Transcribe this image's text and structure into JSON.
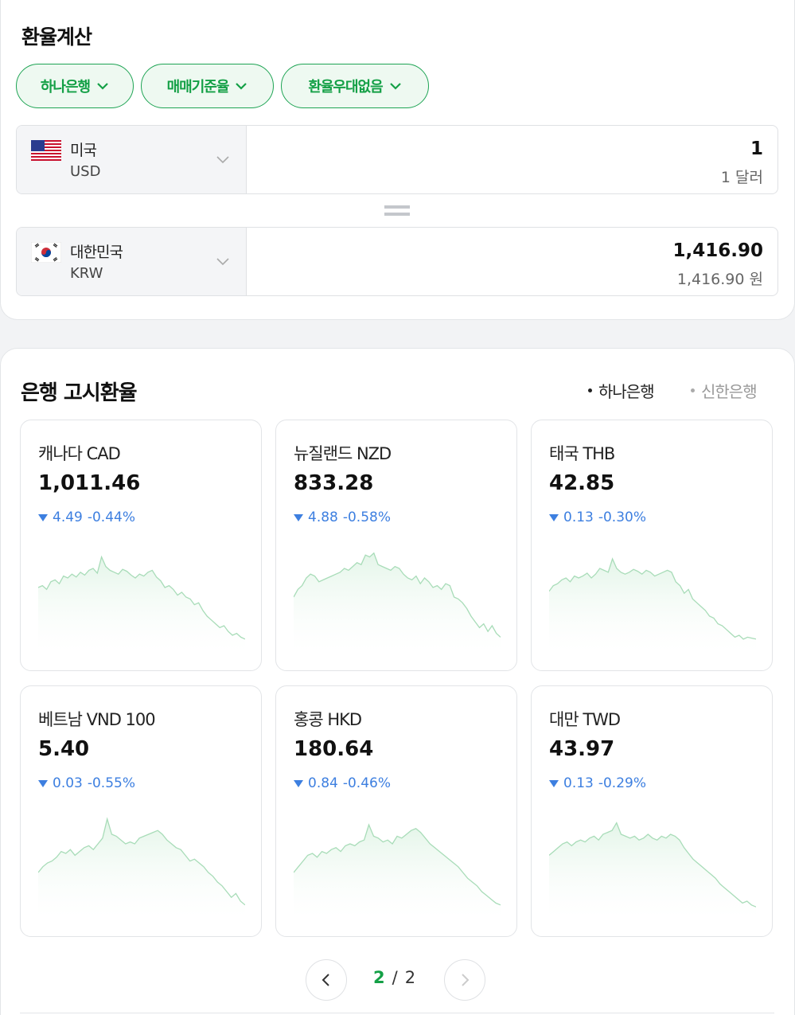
{
  "calculator": {
    "title": "환율계산",
    "chips": [
      {
        "label": "하나은행"
      },
      {
        "label": "매매기준율"
      },
      {
        "label": "환율우대없음"
      }
    ],
    "from": {
      "country": "미국",
      "code": "USD",
      "amount": "1",
      "amount_text": "1 달러",
      "flag": "us-flag-icon"
    },
    "to": {
      "country": "대한민국",
      "code": "KRW",
      "amount": "1,416.90",
      "amount_text": "1,416.90 원",
      "flag": "kr-flag-icon"
    }
  },
  "rates": {
    "title": "은행 고시환율",
    "banks": [
      {
        "label": "하나은행",
        "active": true
      },
      {
        "label": "신한은행",
        "active": false
      }
    ],
    "colors": {
      "accent": "#14a046",
      "down": "#3d7fe0",
      "chart_line": "#a8dcb8",
      "chart_fill": "#e3f5e8"
    },
    "cards": [
      {
        "name": "캐나다 CAD",
        "value": "1,011.46",
        "change": "4.49",
        "percent": "-0.44%",
        "direction": "down",
        "trend": [
          60,
          62,
          58,
          66,
          68,
          64,
          72,
          70,
          74,
          71,
          76,
          73,
          78,
          80,
          75,
          92,
          82,
          78,
          76,
          74,
          79,
          77,
          73,
          70,
          74,
          72,
          76,
          78,
          71,
          67,
          60,
          62,
          58,
          52,
          55,
          50,
          48,
          42,
          44,
          36,
          30,
          26,
          22,
          18,
          20,
          14,
          10,
          12,
          8,
          6
        ]
      },
      {
        "name": "뉴질랜드 NZD",
        "value": "833.28",
        "change": "4.88",
        "percent": "-0.58%",
        "direction": "down",
        "trend": [
          50,
          58,
          62,
          70,
          74,
          72,
          66,
          68,
          70,
          72,
          74,
          76,
          80,
          78,
          82,
          86,
          84,
          94,
          92,
          96,
          84,
          82,
          80,
          78,
          82,
          80,
          74,
          70,
          68,
          72,
          64,
          70,
          66,
          60,
          62,
          58,
          64,
          62,
          50,
          48,
          44,
          38,
          30,
          24,
          18,
          22,
          14,
          20,
          12,
          8
        ]
      },
      {
        "name": "태국 THB",
        "value": "42.85",
        "change": "0.13",
        "percent": "-0.30%",
        "direction": "down",
        "trend": [
          56,
          62,
          64,
          68,
          70,
          66,
          72,
          70,
          72,
          75,
          70,
          74,
          80,
          78,
          76,
          90,
          80,
          76,
          74,
          76,
          79,
          77,
          74,
          78,
          76,
          72,
          74,
          76,
          78,
          76,
          66,
          62,
          54,
          58,
          48,
          44,
          40,
          36,
          30,
          28,
          22,
          20,
          16,
          12,
          8,
          10,
          6,
          8,
          7,
          6
        ]
      }
    ],
    "cards2": [
      {
        "name": "베트남 VND 100",
        "value": "5.40",
        "change": "0.03",
        "percent": "-0.55%",
        "direction": "down",
        "trend": [
          40,
          46,
          50,
          52,
          56,
          62,
          60,
          64,
          58,
          62,
          66,
          68,
          64,
          70,
          76,
          96,
          80,
          78,
          74,
          70,
          72,
          70,
          76,
          78,
          80,
          82,
          84,
          80,
          74,
          70,
          66,
          64,
          58,
          52,
          54,
          50,
          46,
          40,
          36,
          30,
          26,
          20,
          14,
          18,
          10,
          6
        ]
      },
      {
        "name": "홍콩 HKD",
        "value": "180.64",
        "change": "0.84",
        "percent": "-0.46%",
        "direction": "down",
        "trend": [
          40,
          46,
          52,
          58,
          60,
          56,
          62,
          60,
          64,
          66,
          62,
          68,
          70,
          68,
          72,
          74,
          90,
          78,
          76,
          72,
          74,
          70,
          78,
          76,
          80,
          84,
          86,
          82,
          76,
          70,
          66,
          62,
          58,
          54,
          50,
          46,
          40,
          34,
          30,
          26,
          20,
          16,
          12,
          8,
          6
        ]
      },
      {
        "name": "대만 TWD",
        "value": "43.97",
        "change": "0.13",
        "percent": "-0.29%",
        "direction": "down",
        "trend": [
          58,
          62,
          66,
          70,
          72,
          68,
          72,
          74,
          72,
          76,
          78,
          74,
          80,
          82,
          84,
          92,
          80,
          78,
          76,
          78,
          74,
          76,
          80,
          76,
          74,
          78,
          76,
          80,
          78,
          74,
          66,
          60,
          54,
          50,
          46,
          42,
          38,
          34,
          28,
          24,
          20,
          16,
          12,
          8,
          10,
          6,
          4
        ]
      }
    ]
  },
  "pager": {
    "current": "2",
    "separator": "/",
    "total": "2"
  }
}
